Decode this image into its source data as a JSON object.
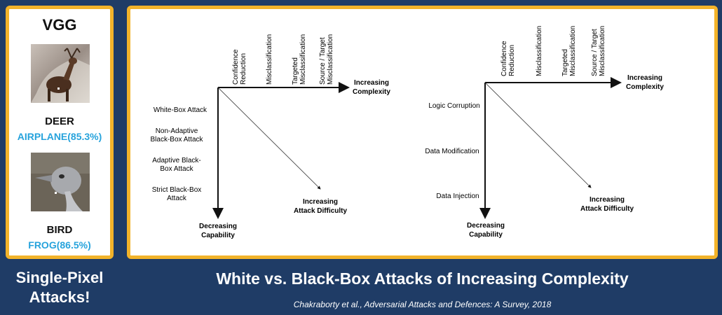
{
  "left_panel": {
    "title": "VGG",
    "examples": [
      {
        "true_label": "DEER",
        "predicted": "AIRPLANE(85.3%)"
      },
      {
        "true_label": "BIRD",
        "predicted": "FROG(86.5%)"
      }
    ],
    "caption_line1": "Single-Pixel",
    "caption_line2": "Attacks!"
  },
  "diagram_left": {
    "top_labels": [
      [
        "Confidence",
        "Reduction"
      ],
      [
        "Misclassification"
      ],
      [
        "Targeted",
        "Misclassification"
      ],
      [
        "Source / Target",
        "Misclassification"
      ]
    ],
    "x_axis_label": [
      "Increasing",
      "Complexity"
    ],
    "side_labels": [
      [
        "White-Box Attack"
      ],
      [
        "Non-Adaptive",
        "Black-Box Attack"
      ],
      [
        "Adaptive Black-",
        "Box Attack"
      ],
      [
        "Strict Black-Box",
        "Attack"
      ]
    ],
    "y_axis_label": [
      "Decreasing",
      "Capability"
    ],
    "diagonal_label": [
      "Increasing",
      "Attack Difficulty"
    ]
  },
  "diagram_right": {
    "top_labels": [
      [
        "Confidence",
        "Reduction"
      ],
      [
        "Misclassification"
      ],
      [
        "Targeted",
        "Misclassification"
      ],
      [
        "Source / Target",
        "Misclassification"
      ]
    ],
    "x_axis_label": [
      "Increasing",
      "Complexity"
    ],
    "side_labels": [
      [
        "Logic Corruption"
      ],
      [
        "Data Modification"
      ],
      [
        "Data Injection"
      ]
    ],
    "y_axis_label": [
      "Decreasing",
      "Capability"
    ],
    "diagonal_label": [
      "Increasing",
      "Attack Difficulty"
    ]
  },
  "title": "White vs. Black-Box Attacks of Increasing Complexity",
  "citation": "Chakraborty et al., Adversarial Attacks and Defences: A Survey, 2018"
}
